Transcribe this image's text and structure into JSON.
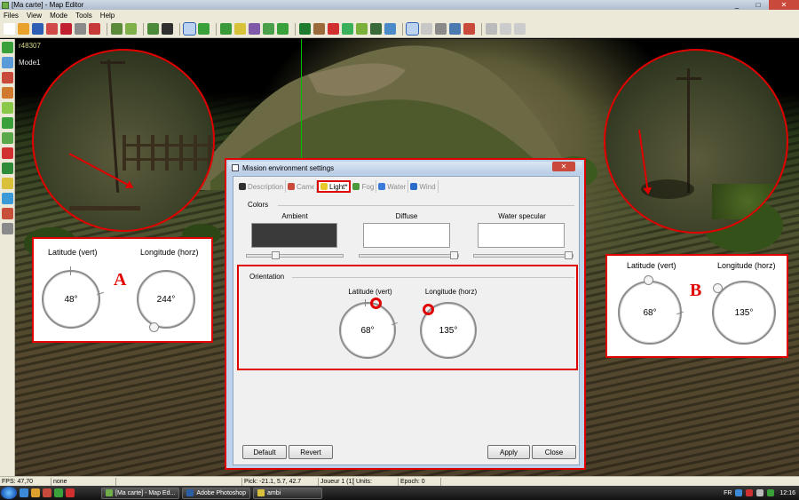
{
  "window": {
    "title": "[Ma carte] - Map Editor",
    "controls": [
      "_",
      "□",
      "✕"
    ]
  },
  "menu": [
    "Files",
    "View",
    "Mode",
    "Tools",
    "Help"
  ],
  "toolbar": {
    "icon_colors": [
      "#ffffff",
      "#e8a12a",
      "#2f5fb4",
      "#d04848",
      "#c02030",
      "#8a8a8a",
      "#c83a3a",
      "#5a8a3a",
      "#7fb04a",
      "#4a8a3a",
      "#303030",
      "#3d8ad6",
      "#39a03a",
      "#3a9a3a",
      "#d8c23a",
      "#7e5aa8",
      "#4aa04a",
      "#3aa03a",
      "#1f7c2f",
      "#9a6a3a",
      "#d03030",
      "#3ab05a",
      "#7ab03a",
      "#3a6a3a",
      "#4a8ac8",
      "#e0a030",
      "#c8c8c8",
      "#8a8a8a",
      "#4a7ab0",
      "#c84a3a",
      "#bbbbbb",
      "#cccccc",
      "#cccccc"
    ]
  },
  "leftbar": {
    "icon_colors": [
      "#3aa03a",
      "#5a9ad8",
      "#c84a3a",
      "#d07a30",
      "#8ac84a",
      "#3aa03a",
      "#5aa84a",
      "#d03030",
      "#2f8a3a",
      "#d8c03a",
      "#3a9ad8",
      "#c8503a",
      "#8a8a8a"
    ]
  },
  "viewport": {
    "hud_fps_id": "r48307",
    "hud_mode": "Mode1"
  },
  "callout_a": {
    "letter": "A",
    "latitude_label": "Latitude (vert)",
    "longitude_label": "Longitude (horz)",
    "latitude_value": "48°",
    "longitude_value": "244°"
  },
  "callout_b": {
    "letter": "B",
    "latitude_label": "Latitude (vert)",
    "longitude_label": "Longitude (horz)",
    "latitude_value": "68°",
    "longitude_value": "135°"
  },
  "dialog": {
    "title": "Mission environment settings",
    "close": "✕",
    "tabs": [
      {
        "label": "Description",
        "icon_color": "#303030"
      },
      {
        "label": "Camera",
        "icon_color": "#c84a3a"
      },
      {
        "label": "Light*",
        "icon_color": "#e8c82a"
      },
      {
        "label": "Fog",
        "icon_color": "#4a9a3a"
      },
      {
        "label": "Water",
        "icon_color": "#3a7ad8"
      },
      {
        "label": "Wind",
        "icon_color": "#2a6ac8"
      }
    ],
    "colors_section": "Colors",
    "ambient_label": "Ambient",
    "diffuse_label": "Diffuse",
    "specular_label": "Water specular",
    "ambient_color": "#3a3a3a",
    "diffuse_color": "#ffffff",
    "specular_color": "#ffffff",
    "orientation_section": "Orientation",
    "latitude_label": "Latitude (vert)",
    "longitude_label": "Longitude (horz)",
    "latitude_value": "68°",
    "longitude_value": "135°",
    "default_button": "Default",
    "revert_button": "Revert",
    "apply_button": "Apply",
    "close_button": "Close"
  },
  "statusbar": [
    "FPS: 47,70",
    "none",
    "",
    "Pick: -21.1, 5.7, 42.7",
    "Joueur 1 (1)",
    "Units:",
    "Epoch: 0"
  ],
  "taskbar": {
    "tasks": [
      "[Ma carte] - Map Ed...",
      "Adobe Photoshop",
      "ambi"
    ],
    "lang": "FR",
    "clock": "12:16"
  }
}
